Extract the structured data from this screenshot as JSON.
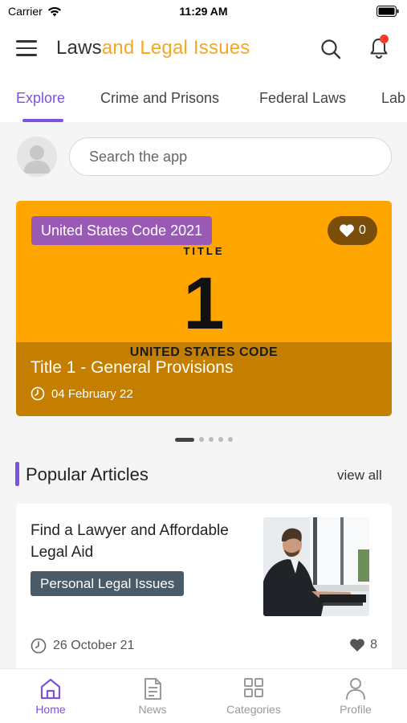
{
  "status": {
    "carrier": "Carrier",
    "time": "11:29 AM"
  },
  "header": {
    "title_part1": "Laws",
    "title_part2": "and Legal Issues"
  },
  "tabs": [
    {
      "label": "Explore",
      "active": true
    },
    {
      "label": "Crime and Prisons"
    },
    {
      "label": "Federal Laws"
    },
    {
      "label": "Lab"
    }
  ],
  "search": {
    "placeholder": "Search the app"
  },
  "featured": {
    "badge": "United States Code 2021",
    "likes": "0",
    "cover_title_word": "TITLE",
    "cover_number": "1",
    "cover_code": "UNITED STATES CODE",
    "title": "Title 1 - General Provisions",
    "date": "04 February 22",
    "pager_count": 5,
    "pager_active": 0
  },
  "popular": {
    "heading": "Popular Articles",
    "view_all": "view all",
    "articles": [
      {
        "title": "Find a Lawyer and Affordable Legal Aid",
        "tag": "Personal Legal Issues",
        "date": "26 October 21",
        "likes": "8"
      }
    ]
  },
  "bottom_nav": [
    {
      "label": "Home",
      "icon": "home-icon",
      "active": true
    },
    {
      "label": "News",
      "icon": "news-icon"
    },
    {
      "label": "Categories",
      "icon": "categories-icon"
    },
    {
      "label": "Profile",
      "icon": "profile-icon"
    }
  ],
  "colors": {
    "accent": "#7b52e3",
    "brand_orange": "#f5a623",
    "card_orange": "#ffa500",
    "badge_purple": "#9b59b6",
    "tag_slate": "#4a5a66"
  }
}
